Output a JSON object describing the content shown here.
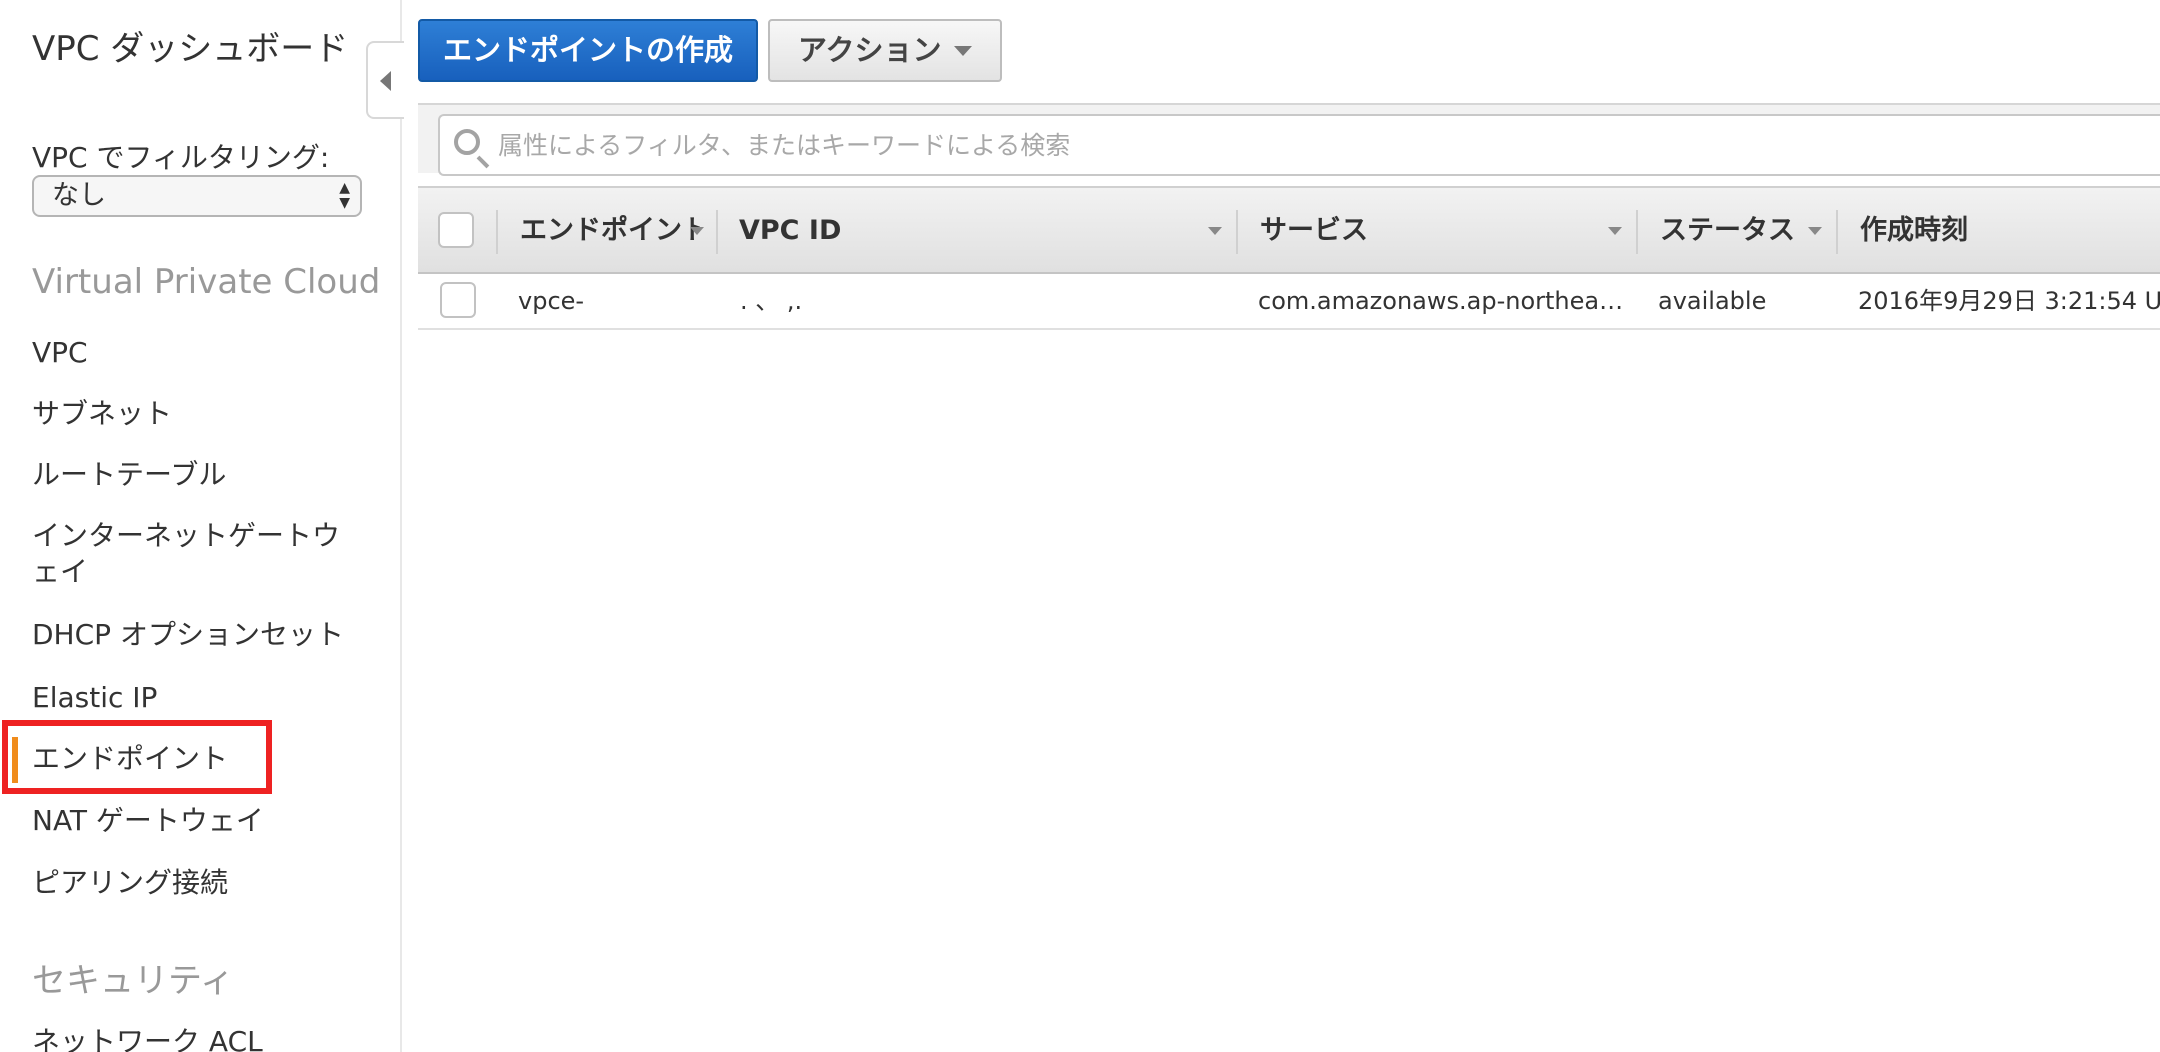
{
  "sidebar": {
    "title": "VPC ダッシュボード",
    "filter_label": "VPC でフィルタリング:",
    "filter_value": "なし",
    "section_vpc": "Virtual Private Cloud",
    "items": [
      {
        "label": "VPC"
      },
      {
        "label": "サブネット"
      },
      {
        "label": "ルートテーブル"
      },
      {
        "label": "インターネットゲートウェイ"
      },
      {
        "label": "DHCP オプションセット"
      },
      {
        "label": "Elastic IP"
      },
      {
        "label": "エンドポイント",
        "active": true
      },
      {
        "label": "NAT ゲートウェイ"
      },
      {
        "label": "ピアリング接続"
      }
    ],
    "section_security": "セキュリティ",
    "security_items": [
      {
        "label": "ネットワーク ACL"
      }
    ]
  },
  "toolbar": {
    "create_label": "エンドポイントの作成",
    "actions_label": "アクション"
  },
  "search": {
    "placeholder": "属性によるフィルタ、またはキーワードによる検索"
  },
  "table": {
    "columns": [
      "エンドポイント",
      "VPC ID",
      "サービス",
      "ステータス",
      "作成時刻"
    ],
    "rows": [
      {
        "endpoint": "vpce-",
        "vpc_id": ".          、          ,.",
        "service": "com.amazonaws.ap-northea…",
        "status": "available",
        "created": "2016年9月29日 3:21:54 U"
      }
    ]
  },
  "colors": {
    "primary_button": "#1a66c2",
    "active_indicator": "#f08c1c",
    "highlight_box": "#ee2222",
    "section_gray": "#999999"
  }
}
